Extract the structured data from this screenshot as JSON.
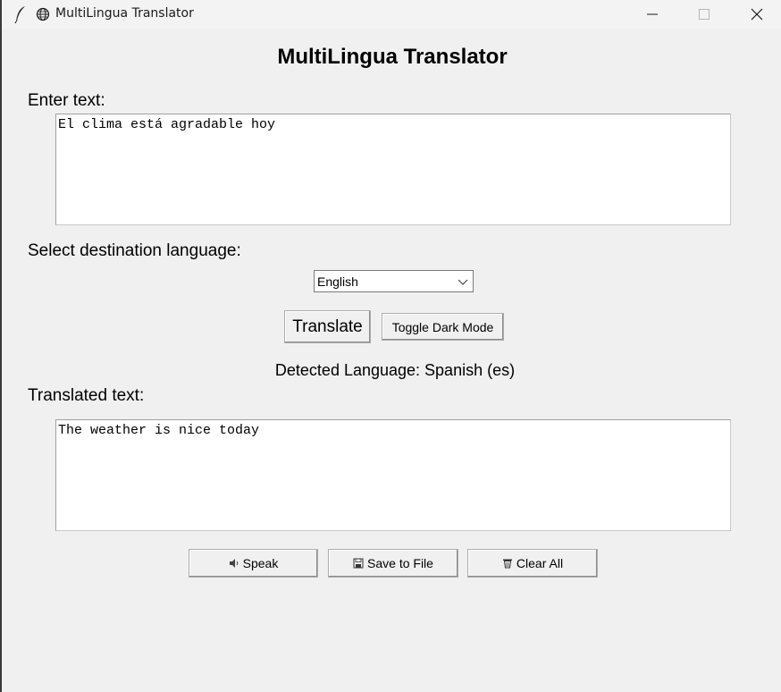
{
  "window": {
    "title": "MultiLingua Translator"
  },
  "app": {
    "heading": "MultiLingua Translator",
    "input_label": "Enter text:",
    "input_text": "El clima está agradable hoy",
    "language_label": "Select destination language:",
    "language_selected": "English",
    "translate_label": "Translate",
    "dark_mode_label": "Toggle Dark Mode",
    "detected_text": "Detected Language: Spanish (es)",
    "output_label": "Translated text:",
    "output_text": "The weather is nice today",
    "speak_label": "Speak",
    "save_label": "Save to File",
    "clear_label": "Clear All"
  },
  "icons": {
    "app": "feather-icon",
    "window": "globe-icon",
    "speak": "speaker-icon",
    "save": "floppy-disk-icon",
    "clear": "wastebasket-icon"
  }
}
